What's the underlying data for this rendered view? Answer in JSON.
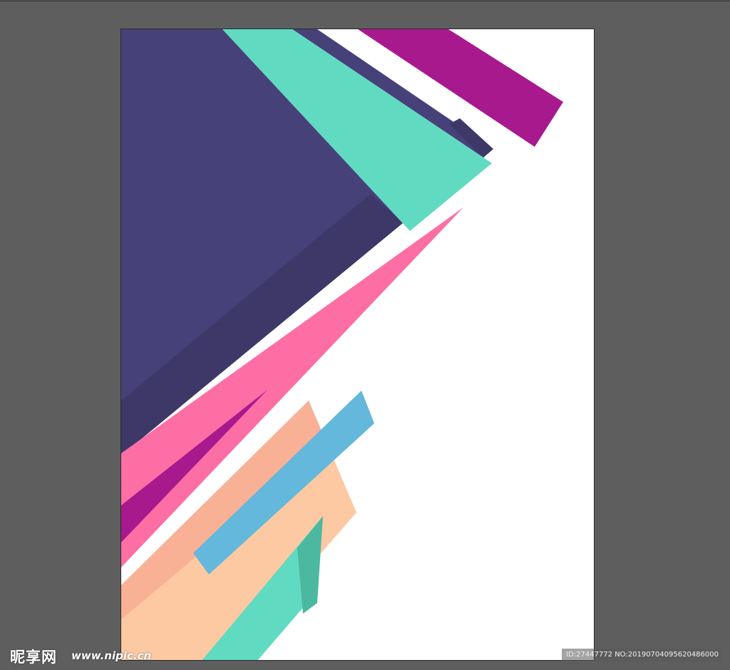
{
  "canvas": {
    "background": "#5e5e5e",
    "artboard_color": "#ffffff"
  },
  "shapes": {
    "navy": "#47417a",
    "navy_shadow": "#3d3868",
    "mint": "#60dbc1",
    "mint_shadow": "#4cb8a0",
    "magenta": "#a8198e",
    "pink": "#fd6ea4",
    "peach": "#fcc9a2",
    "salmon": "#f9b196",
    "sky_blue": "#64b8db"
  },
  "watermark": {
    "logo": "昵享网",
    "url": "www.nipic.cn",
    "id_text": "ID:27447772 NO:20190704095620486000"
  }
}
